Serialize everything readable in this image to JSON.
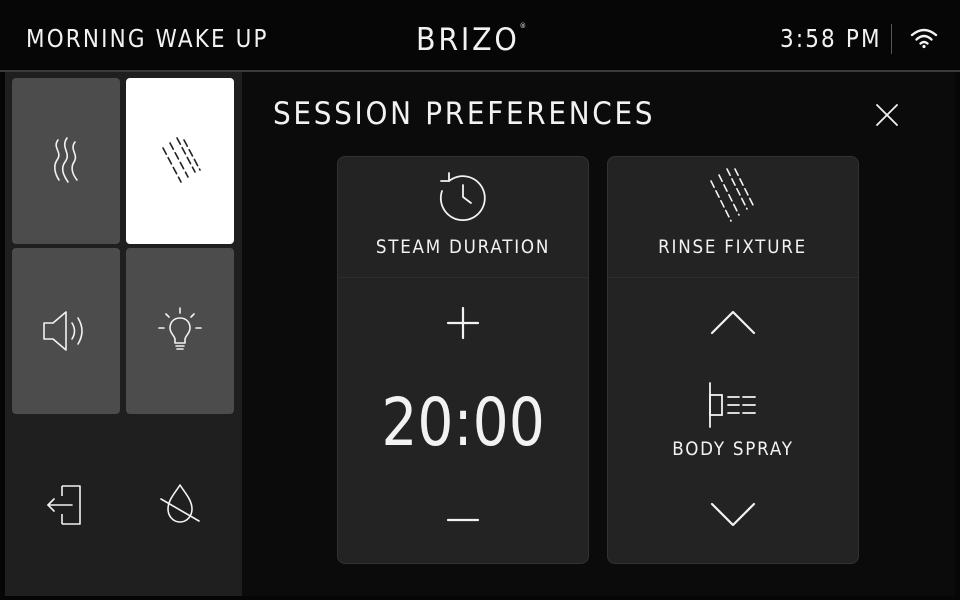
{
  "header": {
    "session_name": "MORNING WAKE UP",
    "brand": "BRIZO",
    "brand_mark": "®",
    "time": "3:58 PM"
  },
  "sidebar": {
    "tiles": [
      {
        "icon": "steam-icon",
        "active": false
      },
      {
        "icon": "rinse-icon",
        "active": true
      },
      {
        "icon": "speaker-icon",
        "active": false
      },
      {
        "icon": "light-bulb-icon",
        "active": false
      },
      {
        "icon": "exit-icon",
        "active": false
      },
      {
        "icon": "water-off-icon",
        "active": false
      }
    ]
  },
  "main": {
    "title": "SESSION PREFERENCES",
    "steam_card": {
      "label": "STEAM DURATION",
      "value": "20:00"
    },
    "rinse_card": {
      "label": "RINSE FIXTURE",
      "fixture": "BODY SPRAY"
    }
  },
  "colors": {
    "background": "#060606",
    "sidebar": "#1f1f1f",
    "tile": "#4c4c4c",
    "tile_active": "#ffffff",
    "card": "#232323",
    "text": "#f2f2f2"
  }
}
